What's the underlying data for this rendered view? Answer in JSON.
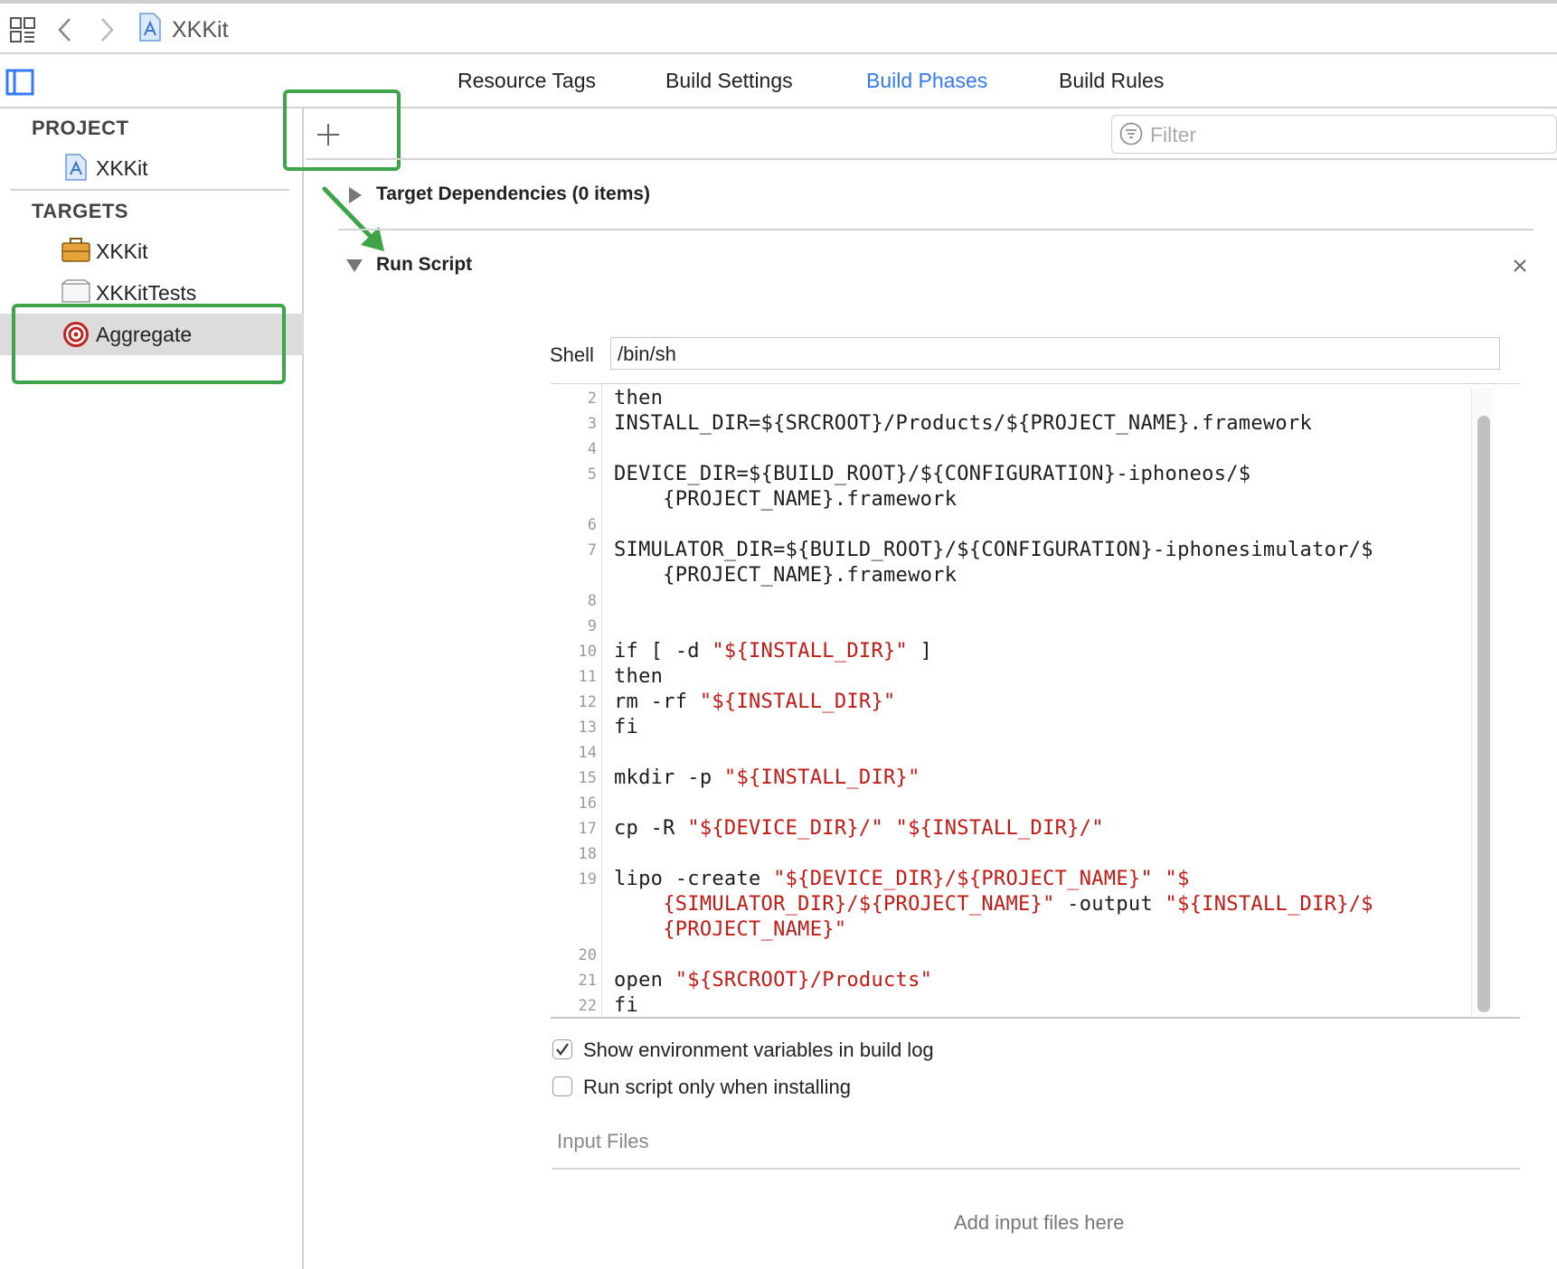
{
  "breadcrumb": {
    "project_name": "XKKit"
  },
  "tabs": [
    {
      "label": "Resource Tags",
      "active": false
    },
    {
      "label": "Build Settings",
      "active": false
    },
    {
      "label": "Build Phases",
      "active": true
    },
    {
      "label": "Build Rules",
      "active": false
    }
  ],
  "sidebar": {
    "project_header": "PROJECT",
    "project_item": "XKKit",
    "targets_header": "TARGETS",
    "targets": [
      {
        "label": "XKKit",
        "icon": "toolbox-icon"
      },
      {
        "label": "XKKitTests",
        "icon": "test-bundle-icon"
      },
      {
        "label": "Aggregate",
        "icon": "target-icon",
        "selected": true
      }
    ]
  },
  "toolbar": {
    "add_label": "+",
    "filter_placeholder": "Filter"
  },
  "phases": {
    "target_dependencies": "Target Dependencies (0 items)",
    "run_script": "Run Script",
    "close_label": "×"
  },
  "shell": {
    "label": "Shell",
    "value": "/bin/sh"
  },
  "script_lines": [
    {
      "n": "2",
      "text": "then"
    },
    {
      "n": "3",
      "text": "INSTALL_DIR=${SRCROOT}/Products/${PROJECT_NAME}.framework"
    },
    {
      "n": "4",
      "text": ""
    },
    {
      "n": "5",
      "text": "DEVICE_DIR=${BUILD_ROOT}/${CONFIGURATION}-iphoneos/$"
    },
    {
      "n": "",
      "text": "    {PROJECT_NAME}.framework"
    },
    {
      "n": "6",
      "text": ""
    },
    {
      "n": "7",
      "text": "SIMULATOR_DIR=${BUILD_ROOT}/${CONFIGURATION}-iphonesimulator/$"
    },
    {
      "n": "",
      "text": "    {PROJECT_NAME}.framework"
    },
    {
      "n": "8",
      "text": ""
    },
    {
      "n": "9",
      "text": ""
    },
    {
      "n": "10",
      "text": "if [ -d ",
      "str": "\"${INSTALL_DIR}\"",
      "tail": " ]"
    },
    {
      "n": "11",
      "text": "then"
    },
    {
      "n": "12",
      "text": "rm -rf ",
      "str": "\"${INSTALL_DIR}\""
    },
    {
      "n": "13",
      "text": "fi"
    },
    {
      "n": "14",
      "text": ""
    },
    {
      "n": "15",
      "text": "mkdir -p ",
      "str": "\"${INSTALL_DIR}\""
    },
    {
      "n": "16",
      "text": ""
    },
    {
      "n": "17",
      "text": "cp -R ",
      "str": "\"${DEVICE_DIR}/\" \"${INSTALL_DIR}/\""
    },
    {
      "n": "18",
      "text": ""
    },
    {
      "n": "19",
      "text": "lipo -create ",
      "str": "\"${DEVICE_DIR}/${PROJECT_NAME}\" \"$"
    },
    {
      "n": "",
      "text": "    ",
      "str": "{SIMULATOR_DIR}/${PROJECT_NAME}\"",
      "tail": " -output ",
      "str2": "\"${INSTALL_DIR}/$"
    },
    {
      "n": "",
      "text": "    ",
      "str": "{PROJECT_NAME}\""
    },
    {
      "n": "20",
      "text": ""
    },
    {
      "n": "21",
      "text": "open ",
      "str": "\"${SRCROOT}/Products\""
    },
    {
      "n": "22",
      "text": "fi"
    }
  ],
  "options": {
    "show_env": {
      "label": "Show environment variables in build log",
      "checked": true
    },
    "install_only": {
      "label": "Run script only when installing",
      "checked": false
    }
  },
  "input_files": {
    "header": "Input Files",
    "placeholder": "Add input files here"
  },
  "colors": {
    "accent": "#3478f6",
    "annotation_green": "#3da548",
    "string_red": "#c41a16"
  }
}
